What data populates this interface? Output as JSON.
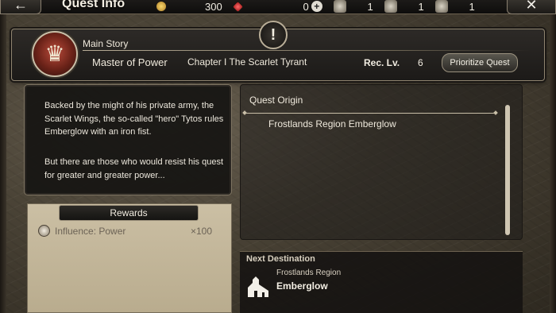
{
  "topbar": {
    "back_icon": "arrow-left-icon",
    "title": "Quest Info",
    "close_icon": "close-icon",
    "coins": "300",
    "gems": "0",
    "ranks": [
      {
        "label": "Rank",
        "value": "1"
      },
      {
        "label": "Rank",
        "value": "1"
      },
      {
        "label": "Rank",
        "value": "1"
      }
    ]
  },
  "header": {
    "category": "Main Story",
    "quest_name": "Master of Power",
    "chapter": "Chapter I The Scarlet Tyrant",
    "rec_lv_label": "Rec. Lv.",
    "rec_lv_value": "6",
    "prioritize_label": "Prioritize Quest",
    "alert_symbol": "!"
  },
  "description": {
    "paragraph1": "Backed by the might of his private army, the Scarlet Wings, the so-called \"hero\" Tytos rules Emberglow with an iron fist.",
    "paragraph2": "But there are those who would resist his quest for greater and greater power..."
  },
  "rewards": {
    "title": "Rewards",
    "items": [
      {
        "name": "Influence: Power",
        "qty": "×100",
        "icon": "influence-icon"
      }
    ]
  },
  "origin": {
    "title": "Quest Origin",
    "location": "Frostlands Region Emberglow"
  },
  "next_destination": {
    "title": "Next Destination",
    "region": "Frostlands Region",
    "town": "Emberglow",
    "icon": "town-icon"
  },
  "colors": {
    "panel_dark": "#161412",
    "parchment": "#c4b79b",
    "text_light": "#ece7dc",
    "accent_border": "#8f8470"
  }
}
